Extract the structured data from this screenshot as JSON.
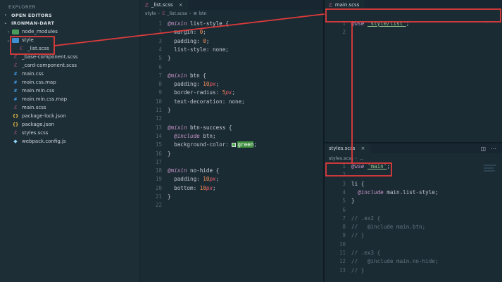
{
  "sidebar": {
    "title": "EXPLORER",
    "open_editors": "OPEN EDITORS",
    "project": "IRONMAN-DART",
    "items": [
      {
        "label": "node_modules",
        "icon": "folder-icon",
        "depth": 1,
        "twisty": "›"
      },
      {
        "label": "style",
        "icon": "folder-open-icon",
        "depth": 1,
        "twisty": "⌄"
      },
      {
        "label": "_list.scss",
        "icon": "sass-icon",
        "depth": 2,
        "twisty": ""
      },
      {
        "label": "_base-component.scss",
        "icon": "sass-icon",
        "depth": 1,
        "twisty": ""
      },
      {
        "label": "_card-component.scss",
        "icon": "sass-icon",
        "depth": 1,
        "twisty": ""
      },
      {
        "label": "main.css",
        "icon": "css-icon",
        "depth": 1,
        "twisty": ""
      },
      {
        "label": "main.css.map",
        "icon": "css-icon",
        "depth": 1,
        "twisty": ""
      },
      {
        "label": "main.min.css",
        "icon": "css-icon",
        "depth": 1,
        "twisty": ""
      },
      {
        "label": "main.min.css.map",
        "icon": "css-icon",
        "depth": 1,
        "twisty": ""
      },
      {
        "label": "main.scss",
        "icon": "sass-icon",
        "depth": 1,
        "twisty": ""
      },
      {
        "label": "package-lock.json",
        "icon": "json-icon",
        "depth": 1,
        "twisty": ""
      },
      {
        "label": "package.json",
        "icon": "json-icon",
        "depth": 1,
        "twisty": ""
      },
      {
        "label": "styles.scss",
        "icon": "sass-icon",
        "depth": 1,
        "twisty": ""
      },
      {
        "label": "webpack.config.js",
        "icon": "webpack-icon",
        "depth": 1,
        "twisty": ""
      }
    ]
  },
  "editor_left": {
    "tab_label": "_list.scss",
    "breadcrumb": [
      "style",
      "_list.scss",
      "btn"
    ],
    "lines": [
      {
        "n": "1",
        "tokens": [
          [
            "kw",
            "@mixin"
          ],
          [
            "fn",
            " list-style "
          ],
          [
            "pn",
            "{"
          ]
        ]
      },
      {
        "n": "2",
        "tokens": [
          [
            "prop",
            "  margin: "
          ],
          [
            "num",
            "0"
          ],
          [
            "pn",
            ";"
          ]
        ]
      },
      {
        "n": "3",
        "tokens": [
          [
            "prop",
            "  padding: "
          ],
          [
            "num",
            "0"
          ],
          [
            "pn",
            ";"
          ]
        ]
      },
      {
        "n": "4",
        "tokens": [
          [
            "prop",
            "  list-style: none;"
          ]
        ]
      },
      {
        "n": "5",
        "tokens": [
          [
            "pn",
            "}"
          ]
        ]
      },
      {
        "n": "6",
        "tokens": []
      },
      {
        "n": "7",
        "tokens": [
          [
            "kw",
            "@mixin"
          ],
          [
            "fn",
            " btn "
          ],
          [
            "pn",
            "{"
          ]
        ]
      },
      {
        "n": "8",
        "tokens": [
          [
            "prop",
            "  padding: "
          ],
          [
            "num",
            "10"
          ],
          [
            "unit",
            "px"
          ],
          [
            "pn",
            ";"
          ]
        ]
      },
      {
        "n": "9",
        "tokens": [
          [
            "prop",
            "  border-radius: "
          ],
          [
            "num",
            "5"
          ],
          [
            "unit",
            "px"
          ],
          [
            "pn",
            ";"
          ]
        ]
      },
      {
        "n": "10",
        "tokens": [
          [
            "prop",
            "  text-decoration: none;"
          ]
        ]
      },
      {
        "n": "11",
        "tokens": [
          [
            "pn",
            "}"
          ]
        ]
      },
      {
        "n": "12",
        "tokens": []
      },
      {
        "n": "13",
        "tokens": [
          [
            "kw",
            "@mixin"
          ],
          [
            "fn",
            " btn-success "
          ],
          [
            "pn",
            "{"
          ]
        ]
      },
      {
        "n": "14",
        "tokens": [
          [
            "atr",
            "  @include"
          ],
          [
            "prop",
            " btn;"
          ]
        ]
      },
      {
        "n": "15",
        "tokens": [
          [
            "prop",
            "  background-color: "
          ],
          [
            "swatch",
            ""
          ],
          [
            "hl-green",
            "green"
          ],
          [
            "pn",
            ";"
          ]
        ]
      },
      {
        "n": "16",
        "tokens": [
          [
            "pn",
            "}"
          ]
        ]
      },
      {
        "n": "17",
        "tokens": []
      },
      {
        "n": "18",
        "tokens": [
          [
            "kw",
            "@mixin"
          ],
          [
            "fn",
            " no-hide "
          ],
          [
            "pn",
            "{"
          ]
        ]
      },
      {
        "n": "19",
        "tokens": [
          [
            "prop",
            "  padding: "
          ],
          [
            "num",
            "10"
          ],
          [
            "unit",
            "px"
          ],
          [
            "pn",
            ";"
          ]
        ]
      },
      {
        "n": "20",
        "tokens": [
          [
            "prop",
            "  bottom: "
          ],
          [
            "num",
            "10"
          ],
          [
            "unit",
            "px"
          ],
          [
            "pn",
            ";"
          ]
        ]
      },
      {
        "n": "21",
        "tokens": [
          [
            "pn",
            "}"
          ]
        ]
      },
      {
        "n": "22",
        "tokens": []
      }
    ]
  },
  "editor_top_right": {
    "tab_label": "main.scss",
    "lines": [
      {
        "n": "1",
        "tokens": [
          [
            "kw",
            "@use"
          ],
          [
            "pn",
            " "
          ],
          [
            "str",
            "'style/list'"
          ],
          [
            "pn",
            ";"
          ]
        ]
      },
      {
        "n": "2",
        "tokens": []
      }
    ]
  },
  "editor_bottom_right": {
    "tab_label": "styles.scss",
    "breadcrumb": [
      "styles.scss",
      "..."
    ],
    "lines": [
      {
        "n": "1",
        "tokens": [
          [
            "kw",
            "@use"
          ],
          [
            "pn",
            " "
          ],
          [
            "str",
            "'main'"
          ],
          [
            "pn",
            ";"
          ]
        ]
      },
      {
        "n": "2",
        "tokens": []
      },
      {
        "n": "3",
        "tokens": [
          [
            "fn",
            "li "
          ],
          [
            "pn",
            "{"
          ]
        ]
      },
      {
        "n": "4",
        "tokens": [
          [
            "atr",
            "  @include"
          ],
          [
            "prop",
            " main.list-style;"
          ]
        ]
      },
      {
        "n": "5",
        "tokens": [
          [
            "pn",
            "}"
          ]
        ]
      },
      {
        "n": "6",
        "tokens": []
      },
      {
        "n": "7",
        "tokens": [
          [
            "cm",
            "// .ex2 {"
          ]
        ]
      },
      {
        "n": "8",
        "tokens": [
          [
            "cm",
            "//   @include main.btn;"
          ]
        ]
      },
      {
        "n": "9",
        "tokens": [
          [
            "cm",
            "// }"
          ]
        ]
      },
      {
        "n": "10",
        "tokens": []
      },
      {
        "n": "11",
        "tokens": [
          [
            "cm",
            "// .ex3 {"
          ]
        ]
      },
      {
        "n": "12",
        "tokens": [
          [
            "cm",
            "//   @include main.no-hide;"
          ]
        ]
      },
      {
        "n": "13",
        "tokens": [
          [
            "cm",
            "// }"
          ]
        ]
      }
    ]
  },
  "colors": {
    "annotation": "#e03b3b",
    "background": "#1b2b34",
    "sidebar": "#1e2e37"
  }
}
